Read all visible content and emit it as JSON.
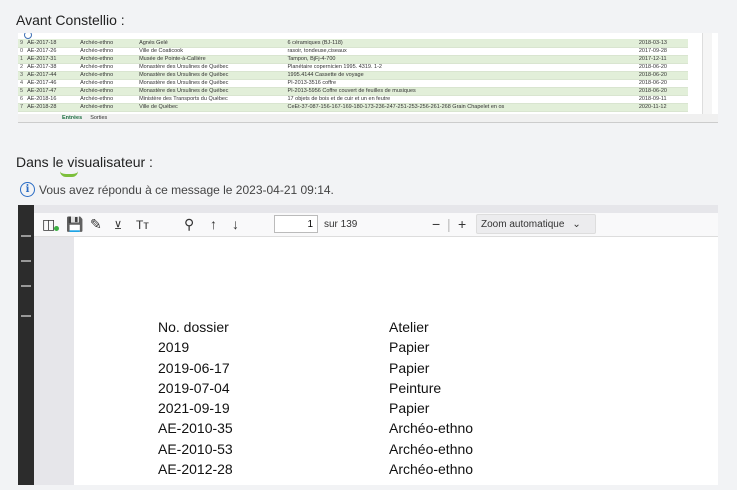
{
  "headings": {
    "before": "Avant Constellio :",
    "viewer": "Dans le visualisateur :"
  },
  "spreadsheet": {
    "rows": [
      {
        "idx": "9",
        "id": "AE-2017-18",
        "type": "Archéo-ethno",
        "owner": "Agnès Gelé",
        "desc": "6 céramiques (BJ-118)",
        "date": "2018-03-13",
        "shade": "g"
      },
      {
        "idx": "0",
        "id": "AE-2017-26",
        "type": "Archéo-ethno",
        "owner": "Ville de Coaticook",
        "desc": "rasoir, tondeuse,ciseaux",
        "date": "2017-09-28",
        "shade": "w"
      },
      {
        "idx": "1",
        "id": "AE-2017-31",
        "type": "Archéo-ethno",
        "owner": "Musée de Pointe-à-Callière",
        "desc": "Tampon, BjFj-4-700",
        "date": "2017-12-11",
        "shade": "g"
      },
      {
        "idx": "2",
        "id": "AE-2017-38",
        "type": "Archéo-ethno",
        "owner": "Monastère des Ursulines de Québec",
        "desc": "Planétaire copernicien 1995. 4319. 1-2",
        "date": "2018-06-20",
        "shade": "w"
      },
      {
        "idx": "3",
        "id": "AE-2017-44",
        "type": "Archéo-ethno",
        "owner": "Monastère des Ursulines de Québec",
        "desc": "1995.4144 Cassette de voyage",
        "date": "2018-06-20",
        "shade": "g"
      },
      {
        "idx": "4",
        "id": "AE-2017-46",
        "type": "Archéo-ethno",
        "owner": "Monastère des Ursulines de Québec",
        "desc": "PI-2013-3516 coffre",
        "date": "2018-06-20",
        "shade": "w"
      },
      {
        "idx": "5",
        "id": "AE-2017-47",
        "type": "Archéo-ethno",
        "owner": "Monastère des Ursulines de Québec",
        "desc": "PI-2013-5956 Coffre couvert de feuilles de musiques",
        "date": "2018-06-20",
        "shade": "g"
      },
      {
        "idx": "6",
        "id": "AE-2018-16",
        "type": "Archéo-ethno",
        "owner": "Ministère des Transports du Québec",
        "desc": "17 objets de bois et de cuir et un en feutre",
        "date": "2018-09-11",
        "shade": "w"
      },
      {
        "idx": "7",
        "id": "AE-2018-28",
        "type": "Archéo-ethno",
        "owner": "Ville de Québec",
        "desc": "CeEt-37-087-156-167-169-180-173-236-247-251-253-256-261-268 Grain Chapelet en os",
        "date": "2020-11-12",
        "shade": "g"
      }
    ],
    "tabs": [
      "Entrées",
      "Sorties"
    ]
  },
  "notice": {
    "icon": "info-icon",
    "text": "Vous avez répondu à ce message le 2023-04-21 09:14."
  },
  "viewer": {
    "page_number": "1",
    "page_total": "sur 139",
    "zoom": "Zoom automatique",
    "col1": [
      "No. dossier",
      "2019",
      "2019-06-17",
      "2019-07-04",
      "2021-09-19",
      "AE-2010-35",
      "AE-2010-53",
      "AE-2012-28"
    ],
    "col2": [
      "Atelier",
      "Papier",
      "Papier",
      "Peinture",
      "Papier",
      "Archéo-ethno",
      "Archéo-ethno",
      "Archéo-ethno"
    ]
  }
}
